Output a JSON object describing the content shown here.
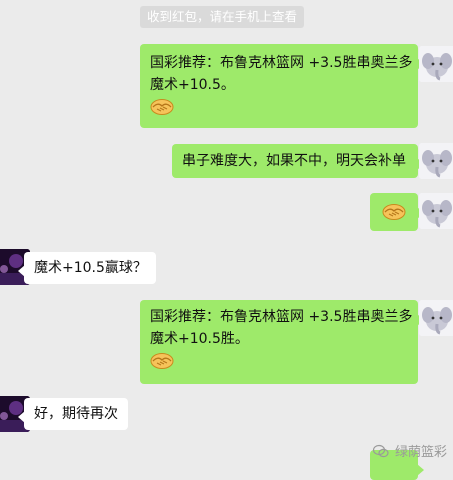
{
  "system_notice": "收到红包，请在手机上查看",
  "messages": [
    {
      "from": "me",
      "lines": [
        "国彩推荐：布鲁克林篮网 +3.5胜串奥兰多",
        "魔术+10.5。"
      ],
      "emoji": "handshake"
    },
    {
      "from": "me",
      "lines": [
        "串子难度大，如果不中，明天会补单"
      ]
    },
    {
      "from": "me",
      "emoji": "handshake"
    },
    {
      "from": "other",
      "lines": [
        "魔术+10.5赢球？"
      ]
    },
    {
      "from": "me",
      "lines": [
        "国彩推荐：布鲁克林篮网 +3.5胜串奥兰多",
        "魔术+10.5胜。"
      ],
      "emoji": "handshake"
    },
    {
      "from": "other",
      "lines": [
        "好，期待再次"
      ]
    }
  ],
  "watermark": "绿荫篮彩",
  "colors": {
    "background": "#ebebeb",
    "outgoing_bubble": "#9eea6a",
    "incoming_bubble": "#ffffff"
  }
}
